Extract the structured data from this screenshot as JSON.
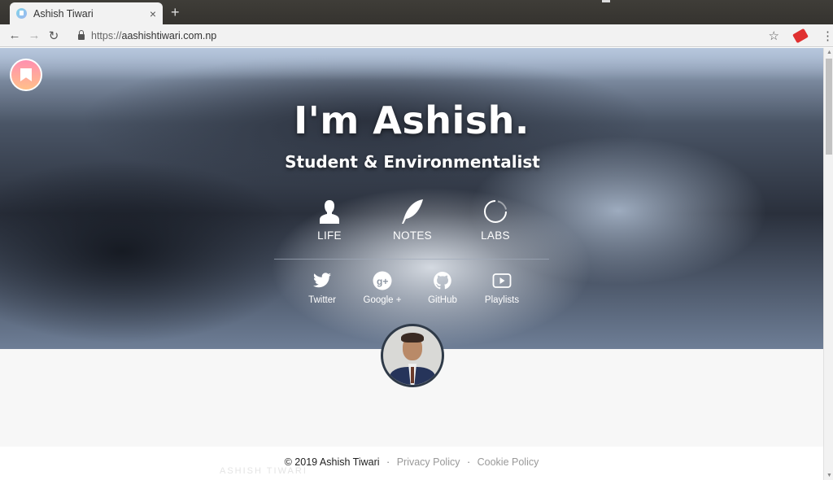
{
  "browser": {
    "tab_title": "Ashish Tiwari",
    "tab_close": "×",
    "new_tab": "+",
    "url_scheme": "https://",
    "url_host": "aashishtiwari.com.np",
    "back": "←",
    "forward": "→",
    "reload": "↻",
    "bookmark_star": "☆",
    "menu": "⋮"
  },
  "hero": {
    "title": "I'm Ashish.",
    "subtitle": "Student & Environmentalist",
    "main_nav": [
      {
        "label": "LIFE",
        "icon": "person-icon"
      },
      {
        "label": "NOTES",
        "icon": "feather-icon"
      },
      {
        "label": "LABS",
        "icon": "spinner-icon"
      }
    ],
    "social_nav": [
      {
        "label": "Twitter",
        "icon": "twitter-icon"
      },
      {
        "label": "Google +",
        "icon": "google-plus-icon"
      },
      {
        "label": "GitHub",
        "icon": "github-icon"
      },
      {
        "label": "Playlists",
        "icon": "play-icon"
      }
    ]
  },
  "footer": {
    "copyright": "© 2019 Ashish Tiwari",
    "separator": "·",
    "privacy": "Privacy Policy",
    "cookie": "Cookie Policy",
    "watermark": "ASHISH TIWARI"
  },
  "scrollbar": {
    "up": "▲",
    "down": "▼"
  }
}
